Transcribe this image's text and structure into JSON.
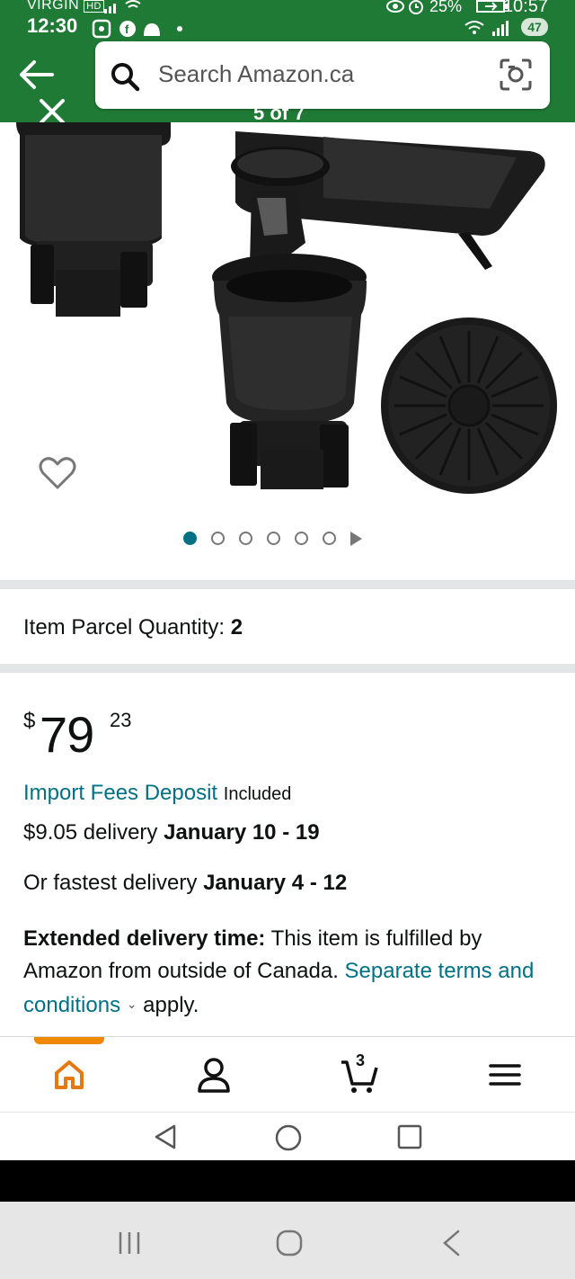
{
  "status_bar": {
    "carrier": "VIRGIN",
    "carrier_badge": "HD",
    "time_left": "12:30",
    "battery_pct": "25%",
    "time_right": "10:57",
    "notification_count": "47"
  },
  "header": {
    "search_placeholder": "Search Amazon.ca",
    "image_counter": "5 of 7"
  },
  "gallery": {
    "dot_count": 6,
    "active_dot": 0
  },
  "product": {
    "quantity_label": "Item Parcel Quantity:",
    "quantity_value": "2",
    "price_currency": "$",
    "price_whole": "79",
    "price_fraction": "23",
    "import_fees_link": "Import Fees Deposit",
    "import_fees_status": "Included",
    "delivery_prefix": "$9.05 delivery",
    "delivery_dates": "January 10 - 19",
    "fastest_prefix": "Or fastest delivery",
    "fastest_dates": "January 4 - 12",
    "extended_label": "Extended delivery time:",
    "extended_text": "This item is fulfilled by Amazon from outside of Canada.",
    "terms_link": "Separate terms and conditions",
    "extended_suffix": "apply."
  },
  "bottom_nav": {
    "cart_count": "3",
    "items": [
      "home-icon",
      "account-icon",
      "cart-icon",
      "menu-icon"
    ]
  },
  "colors": {
    "header_green": "#1f7a35",
    "link": "#007185",
    "accent_orange": "#f08804"
  }
}
